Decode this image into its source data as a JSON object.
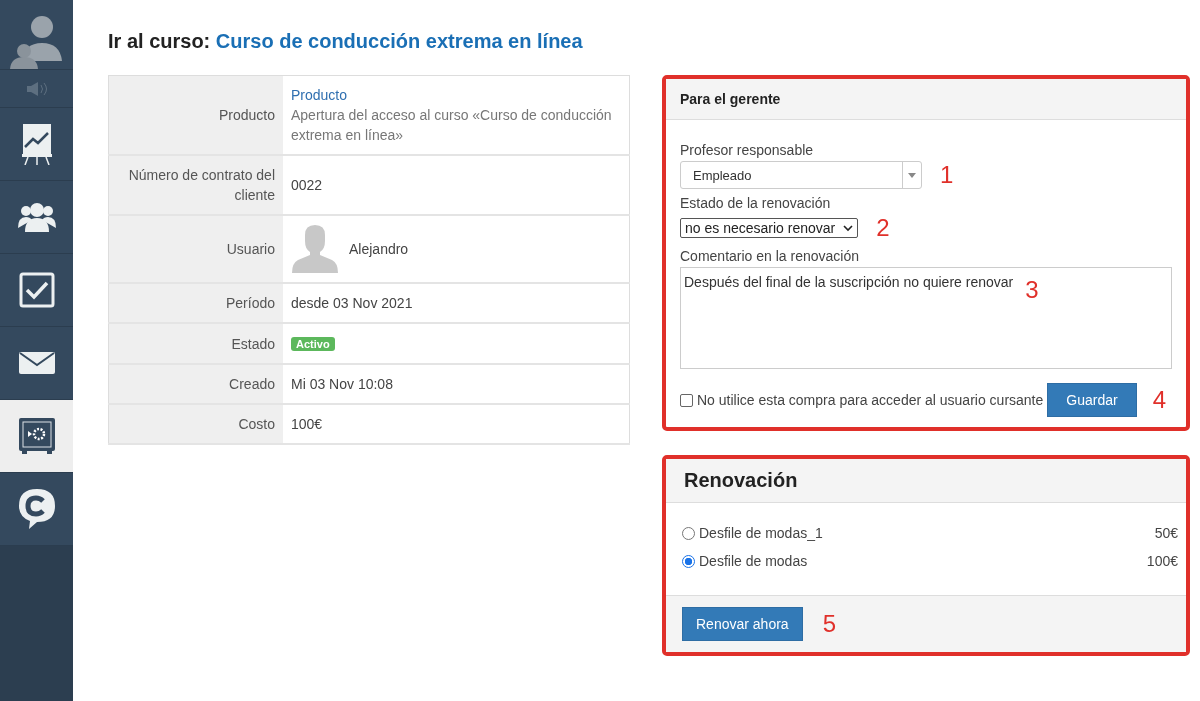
{
  "sidebar": {
    "items": [
      {
        "kind": "user",
        "selected": false
      },
      {
        "kind": "speaker",
        "selected": false
      },
      {
        "kind": "chart",
        "selected": false
      },
      {
        "kind": "group",
        "selected": false
      },
      {
        "kind": "task",
        "selected": false
      },
      {
        "kind": "mail",
        "selected": false
      },
      {
        "kind": "safe",
        "selected": true
      },
      {
        "kind": "chat",
        "selected": false
      }
    ]
  },
  "heading": {
    "prefix": "Ir al curso:",
    "link": "Curso de conducción extrema en línea"
  },
  "details": [
    {
      "kind": "product",
      "label": "Producto",
      "link": "Producto",
      "value": "Apertura del acceso al curso «Curso de conducción extrema en línea»"
    },
    {
      "kind": "text",
      "label": "Número de contrato del cliente",
      "value": "0022"
    },
    {
      "kind": "user",
      "label": "Usuario",
      "value": "Alejandro"
    },
    {
      "kind": "text",
      "label": "Período",
      "value": "desde 03 Nov 2021"
    },
    {
      "kind": "badge",
      "label": "Estado",
      "value": "Activo",
      "color": "#5cb85c"
    },
    {
      "kind": "text",
      "label": "Creado",
      "value": "Mi 03 Nov 10:08"
    },
    {
      "kind": "text",
      "label": "Costo",
      "value": "100€"
    }
  ],
  "manager_panel": {
    "title": "Para el gerente",
    "teacher_label": "Profesor responsable",
    "teacher_value": "Empleado",
    "renewal_status_label": "Estado de la renovación",
    "renewal_status_value": "no es necesario renovar",
    "comment_label": "Comentario en la renovación",
    "comment_value": "Después del final de la suscripción no quiere renovar",
    "checkbox": {
      "label": "No utilice esta compra para acceder al usuario cursante",
      "checked": false
    },
    "save_button": "Guardar"
  },
  "renewal_panel": {
    "title": "Renovación",
    "options": [
      {
        "label": "Desfile de modas_1",
        "price": "50€",
        "selected": false
      },
      {
        "label": "Desfile de modas",
        "price": "100€",
        "selected": true
      }
    ],
    "button": "Renovar ahora"
  },
  "annotations": [
    "1",
    "2",
    "3",
    "4",
    "5"
  ]
}
